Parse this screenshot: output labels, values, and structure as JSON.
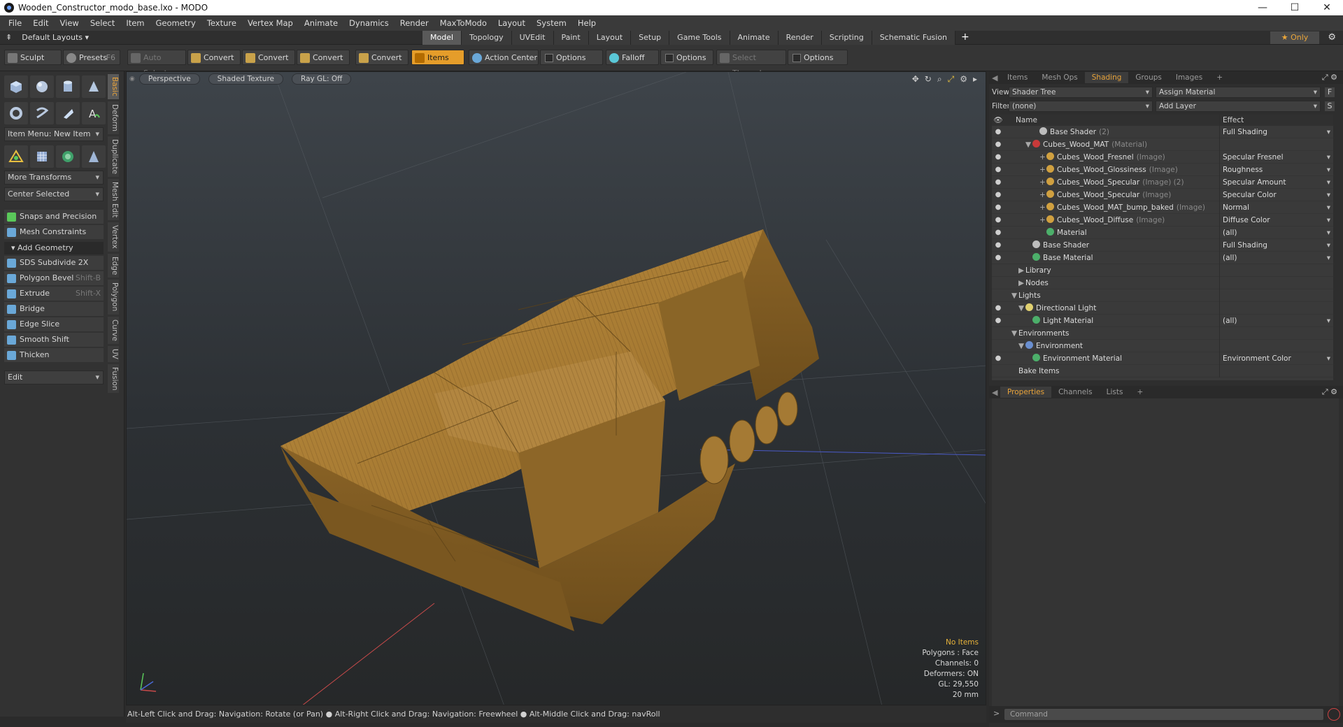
{
  "window": {
    "title": "Wooden_Constructor_modo_base.lxo - MODO"
  },
  "menu": [
    "File",
    "Edit",
    "View",
    "Select",
    "Item",
    "Geometry",
    "Texture",
    "Vertex Map",
    "Animate",
    "Dynamics",
    "Render",
    "MaxToModo",
    "Layout",
    "System",
    "Help"
  ],
  "layout": {
    "default_layouts": "Default Layouts",
    "tabs": [
      "Model",
      "Topology",
      "UVEdit",
      "Paint",
      "Layout",
      "Setup",
      "Game Tools",
      "Animate",
      "Render",
      "Scripting",
      "Schematic Fusion"
    ],
    "active_tab": "Model",
    "only": "Only"
  },
  "toolbar": {
    "sculpt": "Sculpt",
    "presets": "Presets",
    "presets_key": "F6",
    "auto_select": "Auto Select",
    "convert1": "Convert",
    "convert2": "Convert",
    "convert3": "Convert",
    "convert4": "Convert",
    "items": "Items",
    "action_center": "Action Center",
    "options1": "Options",
    "falloff": "Falloff",
    "options2": "Options",
    "select_through": "Select Through",
    "options3": "Options"
  },
  "left": {
    "item_menu": "Item Menu: New Item",
    "more_transforms": "More Transforms",
    "center_selected": "Center Selected",
    "snaps": "Snaps and Precision",
    "mesh_constraints": "Mesh Constraints",
    "add_geometry": "Add Geometry",
    "tools": [
      {
        "label": "SDS Subdivide 2X",
        "key": ""
      },
      {
        "label": "Polygon Bevel",
        "key": "Shift-B"
      },
      {
        "label": "Extrude",
        "key": "Shift-X"
      },
      {
        "label": "Bridge",
        "key": ""
      },
      {
        "label": "Edge Slice",
        "key": ""
      },
      {
        "label": "Smooth Shift",
        "key": ""
      },
      {
        "label": "Thicken",
        "key": ""
      }
    ],
    "edit": "Edit",
    "vtabs": [
      "Basic",
      "Deform",
      "Duplicate",
      "Mesh Edit",
      "Vertex",
      "Edge",
      "Polygon",
      "Curve",
      "UV",
      "Fusion"
    ]
  },
  "viewport": {
    "perspective": "Perspective",
    "shaded": "Shaded Texture",
    "raygl": "Ray GL: Off",
    "info": {
      "no_items": "No Items",
      "polygons": "Polygons : Face",
      "channels": "Channels: 0",
      "deformers": "Deformers: ON",
      "gl": "GL: 29,550",
      "size": "20 mm"
    }
  },
  "status": "Alt-Left Click and Drag: Navigation: Rotate (or Pan) ● Alt-Right Click and Drag: Navigation: Freewheel ● Alt-Middle Click and Drag: navRoll",
  "right": {
    "tabs": [
      "Items",
      "Mesh Ops",
      "Shading",
      "Groups",
      "Images"
    ],
    "active_tab": "Shading",
    "view_label": "View",
    "view_value": "Shader Tree",
    "assign_material": "Assign Material",
    "filter_label": "Filter",
    "filter_value": "(none)",
    "add_layer": "Add Layer",
    "col_name": "Name",
    "col_effect": "Effect",
    "rows": [
      {
        "indent": 3,
        "eye": true,
        "twisty": "",
        "ball": "#bdbdbd",
        "name": "Base Shader",
        "suffix": "(2)",
        "effect": "Full Shading"
      },
      {
        "indent": 2,
        "eye": true,
        "twisty": "▼",
        "ball": "#c83a3a",
        "name": "Cubes_Wood_MAT",
        "suffix": "(Material)",
        "effect": ""
      },
      {
        "indent": 4,
        "eye": true,
        "twisty": "+",
        "ball": "#d0a040",
        "name": "Cubes_Wood_Fresnel",
        "suffix": "(Image)",
        "effect": "Specular Fresnel"
      },
      {
        "indent": 4,
        "eye": true,
        "twisty": "+",
        "ball": "#d0a040",
        "name": "Cubes_Wood_Glossiness",
        "suffix": "(Image)",
        "effect": "Roughness"
      },
      {
        "indent": 4,
        "eye": true,
        "twisty": "+",
        "ball": "#d0a040",
        "name": "Cubes_Wood_Specular",
        "suffix": "(Image) (2)",
        "effect": "Specular Amount"
      },
      {
        "indent": 4,
        "eye": true,
        "twisty": "+",
        "ball": "#d0a040",
        "name": "Cubes_Wood_Specular",
        "suffix": "(Image)",
        "effect": "Specular Color"
      },
      {
        "indent": 4,
        "eye": true,
        "twisty": "+",
        "ball": "#d0a040",
        "name": "Cubes_Wood_MAT_bump_baked",
        "suffix": "(Image)",
        "effect": "Normal"
      },
      {
        "indent": 4,
        "eye": true,
        "twisty": "+",
        "ball": "#d0a040",
        "name": "Cubes_Wood_Diffuse",
        "suffix": "(Image)",
        "effect": "Diffuse Color"
      },
      {
        "indent": 4,
        "eye": true,
        "twisty": "",
        "ball": "#4caf6a",
        "name": "Material",
        "suffix": "",
        "effect": "(all)"
      },
      {
        "indent": 2,
        "eye": true,
        "twisty": "",
        "ball": "#bdbdbd",
        "name": "Base Shader",
        "suffix": "",
        "effect": "Full Shading"
      },
      {
        "indent": 2,
        "eye": true,
        "twisty": "",
        "ball": "#4caf6a",
        "name": "Base Material",
        "suffix": "",
        "effect": "(all)"
      },
      {
        "indent": 1,
        "eye": false,
        "twisty": "▶",
        "ball": "",
        "name": "Library",
        "suffix": "",
        "effect": ""
      },
      {
        "indent": 1,
        "eye": false,
        "twisty": "▶",
        "ball": "",
        "name": "Nodes",
        "suffix": "",
        "effect": ""
      },
      {
        "indent": 0,
        "eye": false,
        "twisty": "▼",
        "ball": "",
        "name": "Lights",
        "suffix": "",
        "effect": ""
      },
      {
        "indent": 1,
        "eye": true,
        "twisty": "▼",
        "ball": "#e0d070",
        "name": "Directional Light",
        "suffix": "",
        "effect": ""
      },
      {
        "indent": 2,
        "eye": true,
        "twisty": "",
        "ball": "#4caf6a",
        "name": "Light Material",
        "suffix": "",
        "effect": "(all)"
      },
      {
        "indent": 0,
        "eye": false,
        "twisty": "▼",
        "ball": "",
        "name": "Environments",
        "suffix": "",
        "effect": ""
      },
      {
        "indent": 1,
        "eye": false,
        "twisty": "▼",
        "ball": "#6a8fd0",
        "name": "Environment",
        "suffix": "",
        "effect": ""
      },
      {
        "indent": 2,
        "eye": true,
        "twisty": "",
        "ball": "#4caf6a",
        "name": "Environment Material",
        "suffix": "",
        "effect": "Environment Color"
      },
      {
        "indent": 0,
        "eye": false,
        "twisty": "",
        "ball": "",
        "name": "Bake Items",
        "suffix": "",
        "effect": ""
      }
    ],
    "props_tabs": [
      "Properties",
      "Channels",
      "Lists"
    ],
    "command_placeholder": "Command"
  }
}
